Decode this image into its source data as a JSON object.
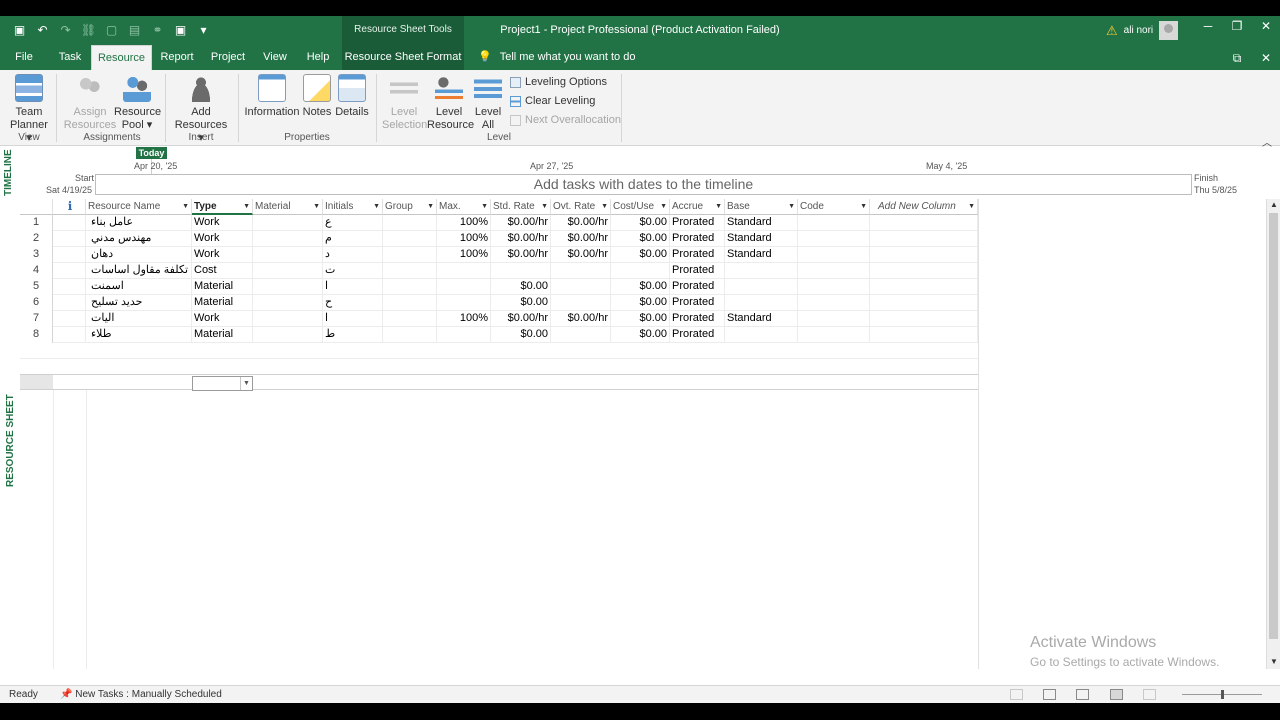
{
  "title_bar": {
    "contextual_tab_group": "Resource Sheet Tools",
    "window_title": "Project1  -  Project Professional (Product Activation Failed)",
    "user_name": "ali nori"
  },
  "tabs": [
    {
      "label": "File"
    },
    {
      "label": "Task"
    },
    {
      "label": "Resource"
    },
    {
      "label": "Report"
    },
    {
      "label": "Project"
    },
    {
      "label": "View"
    },
    {
      "label": "Help"
    },
    {
      "label": "Resource Sheet Format"
    }
  ],
  "tell_me": "Tell me what you want to do",
  "ribbon": {
    "view_group": {
      "label": "View",
      "team_planner_line1": "Team",
      "team_planner_line2": "Planner ▾"
    },
    "assignments_group": {
      "label": "Assignments",
      "assign_line1": "Assign",
      "assign_line2": "Resources",
      "pool_line1": "Resource",
      "pool_line2": "Pool ▾"
    },
    "insert_group": {
      "label": "Insert",
      "add_line1": "Add",
      "add_line2": "Resources ▾"
    },
    "properties_group": {
      "label": "Properties",
      "information": "Information",
      "notes": "Notes",
      "details": "Details"
    },
    "level_group": {
      "label": "Level",
      "level_selection_line1": "Level",
      "level_selection_line2": "Selection",
      "level_resource_line1": "Level",
      "level_resource_line2": "Resource",
      "level_all_line1": "Level",
      "level_all_line2": "All",
      "leveling_options": "Leveling Options",
      "clear_leveling": "Clear Leveling",
      "next_overallocation": "Next Overallocation"
    }
  },
  "timeline": {
    "side_label": "TIMELINE",
    "today": "Today",
    "dates": [
      "Apr 20, '25",
      "Apr 27, '25",
      "May 4, '25"
    ],
    "start_label": "Start",
    "start_date": "Sat 4/19/25",
    "finish_label": "Finish",
    "finish_date": "Thu 5/8/25",
    "placeholder": "Add tasks with dates to the timeline"
  },
  "sheet": {
    "side_label": "RESOURCE SHEET",
    "columns": [
      "Resource Name",
      "Type",
      "Material",
      "Initials",
      "Group",
      "Max.",
      "Std. Rate",
      "Ovt. Rate",
      "Cost/Use",
      "Accrue",
      "Base",
      "Code",
      "Add New Column"
    ],
    "rows": [
      {
        "id": "1",
        "name": "عامل بناء",
        "type": "Work",
        "material": "",
        "initials": "ع",
        "group": "",
        "max": "100%",
        "std": "$0.00/hr",
        "ovt": "$0.00/hr",
        "cost": "$0.00",
        "accrue": "Prorated",
        "base": "Standard",
        "code": ""
      },
      {
        "id": "2",
        "name": "مهندس مدني",
        "type": "Work",
        "material": "",
        "initials": "م",
        "group": "",
        "max": "100%",
        "std": "$0.00/hr",
        "ovt": "$0.00/hr",
        "cost": "$0.00",
        "accrue": "Prorated",
        "base": "Standard",
        "code": ""
      },
      {
        "id": "3",
        "name": "دهان",
        "type": "Work",
        "material": "",
        "initials": "د",
        "group": "",
        "max": "100%",
        "std": "$0.00/hr",
        "ovt": "$0.00/hr",
        "cost": "$0.00",
        "accrue": "Prorated",
        "base": "Standard",
        "code": ""
      },
      {
        "id": "4",
        "name": "تكلفة مقاول اساسات",
        "type": "Cost",
        "material": "",
        "initials": "ت",
        "group": "",
        "max": "",
        "std": "",
        "ovt": "",
        "cost": "",
        "accrue": "Prorated",
        "base": "",
        "code": ""
      },
      {
        "id": "5",
        "name": "اسمنت",
        "type": "Material",
        "material": "",
        "initials": "ا",
        "group": "",
        "max": "",
        "std": "$0.00",
        "ovt": "",
        "cost": "$0.00",
        "accrue": "Prorated",
        "base": "",
        "code": ""
      },
      {
        "id": "6",
        "name": "حديد تسليح",
        "type": "Material",
        "material": "",
        "initials": "ح",
        "group": "",
        "max": "",
        "std": "$0.00",
        "ovt": "",
        "cost": "$0.00",
        "accrue": "Prorated",
        "base": "",
        "code": ""
      },
      {
        "id": "7",
        "name": "اليات",
        "type": "Work",
        "material": "",
        "initials": "ا",
        "group": "",
        "max": "100%",
        "std": "$0.00/hr",
        "ovt": "$0.00/hr",
        "cost": "$0.00",
        "accrue": "Prorated",
        "base": "Standard",
        "code": ""
      },
      {
        "id": "8",
        "name": "طلاء",
        "type": "Material",
        "material": "",
        "initials": "ط",
        "group": "",
        "max": "",
        "std": "$0.00",
        "ovt": "",
        "cost": "$0.00",
        "accrue": "Prorated",
        "base": "",
        "code": ""
      }
    ]
  },
  "watermark": {
    "line1": "Activate Windows",
    "line2": "Go to Settings to activate Windows."
  },
  "status": {
    "ready": "Ready",
    "new_tasks": "New Tasks : Manually Scheduled"
  },
  "colors": {
    "accent": "#217346",
    "ribbon_bg": "#f3f3f3"
  }
}
